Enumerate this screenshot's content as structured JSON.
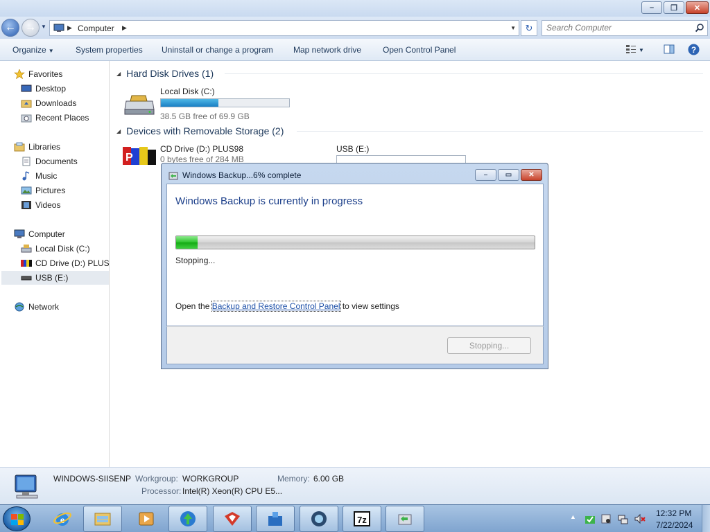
{
  "window": {
    "controls": {
      "minimize": "–",
      "maximize": "❐",
      "close": "✕"
    }
  },
  "address": {
    "path": "Computer",
    "search_placeholder": "Search Computer"
  },
  "toolbar": {
    "organize": "Organize",
    "system_properties": "System properties",
    "uninstall": "Uninstall or change a program",
    "map_drive": "Map network drive",
    "control_panel": "Open Control Panel"
  },
  "nav": {
    "favorites": "Favorites",
    "desktop": "Desktop",
    "downloads": "Downloads",
    "recent_places": "Recent Places",
    "libraries": "Libraries",
    "documents": "Documents",
    "music": "Music",
    "pictures": "Pictures",
    "videos": "Videos",
    "computer": "Computer",
    "local_disk": "Local Disk (C:)",
    "cd_drive": "CD Drive (D:) PLUS98",
    "usb": "USB (E:)",
    "network": "Network"
  },
  "content": {
    "hdd_header": "Hard Disk Drives (1)",
    "removable_header": "Devices with Removable Storage (2)",
    "local_disk": {
      "name": "Local Disk (C:)",
      "free": "38.5 GB free of 69.9 GB",
      "used_fraction": 0.45
    },
    "cd_drive": {
      "name": "CD Drive (D:) PLUS98",
      "free": "0 bytes free of 284 MB"
    },
    "usb": {
      "name": "USB (E:)"
    }
  },
  "details": {
    "computer_name": "WINDOWS-SIISENP",
    "workgroup_label": "Workgroup:",
    "workgroup": "WORKGROUP",
    "memory_label": "Memory:",
    "memory": "6.00 GB",
    "processor_label": "Processor:",
    "processor": "Intel(R) Xeon(R) CPU E5..."
  },
  "dialog": {
    "title": "Windows Backup...6% complete",
    "heading": "Windows Backup is currently in progress",
    "progress_fraction": 0.06,
    "status": "Stopping...",
    "link_prefix": "Open the ",
    "link_text": "Backup and Restore Control Panel",
    "link_suffix": " to view settings",
    "button": "Stopping..."
  },
  "taskbar": {
    "time": "12:32 PM",
    "date": "7/22/2024",
    "apps": [
      "windows-explorer",
      "internet-explorer",
      "file-explorer",
      "media-player",
      "download-manager",
      "app-red",
      "app-blue",
      "app-globe",
      "7zip",
      "windows-backup"
    ]
  },
  "colors": {
    "progress_green": "#14a914",
    "disk_bar_blue": "#1a7fc3",
    "heading_blue": "#1c3f8a"
  }
}
